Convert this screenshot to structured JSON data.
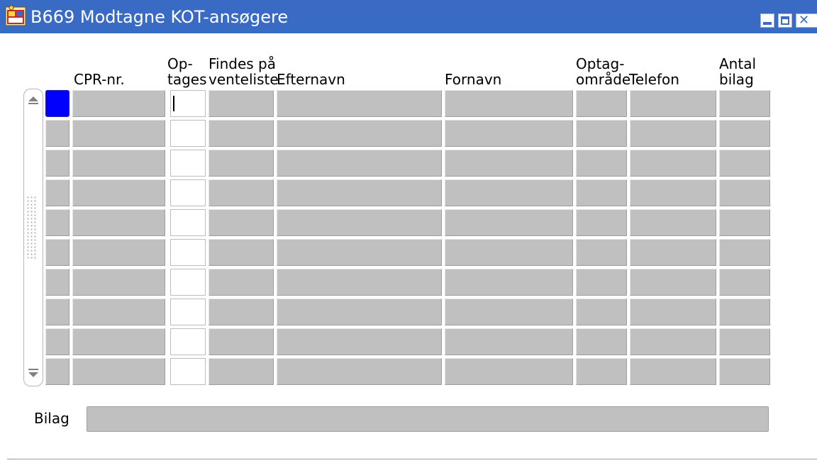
{
  "window": {
    "title": "B669 Modtagne KOT-ansøgere",
    "controls": [
      "minimize",
      "maximize",
      "close"
    ],
    "titlebar_color": "#3a6bc4"
  },
  "table": {
    "columns": [
      {
        "key": "indicator",
        "label": ""
      },
      {
        "key": "cpr",
        "label": "CPR-nr."
      },
      {
        "key": "optages",
        "label": "Op-\ntages"
      },
      {
        "key": "venteliste",
        "label": "Findes på\nventeliste"
      },
      {
        "key": "efternavn",
        "label": "Efternavn"
      },
      {
        "key": "fornavn",
        "label": "Fornavn"
      },
      {
        "key": "omraade",
        "label": "Optag-\nområde"
      },
      {
        "key": "telefon",
        "label": "Telefon"
      },
      {
        "key": "bilag",
        "label": "Antal\nbilag"
      }
    ],
    "row_count": 10,
    "active_row": 0,
    "cell_color": "#c0c0c0",
    "active_indicator_color": "#0000ff"
  },
  "bilag": {
    "label": "Bilag",
    "value": ""
  }
}
